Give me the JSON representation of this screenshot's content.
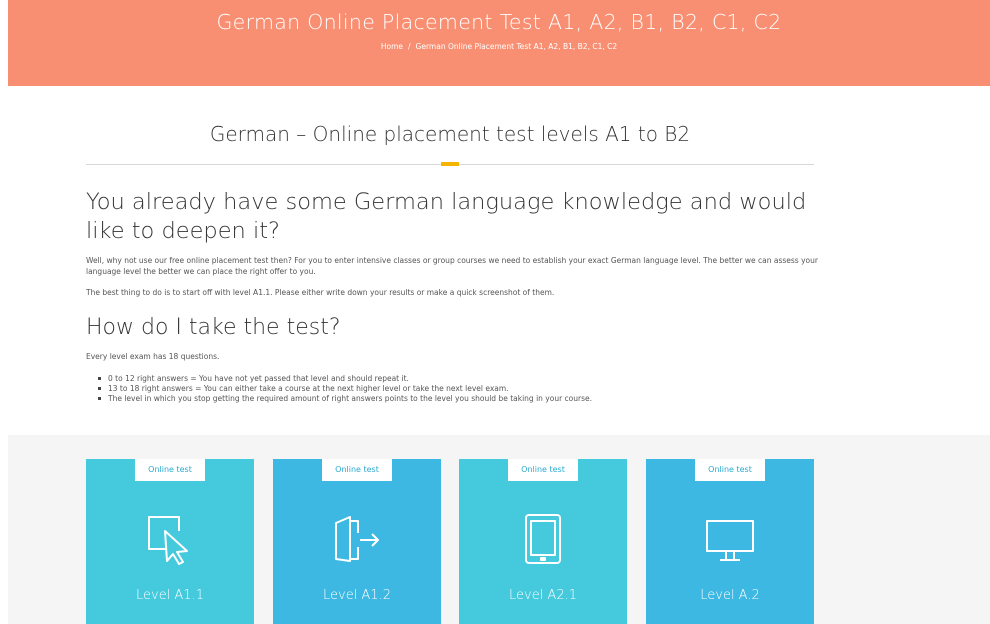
{
  "header": {
    "title": "German Online Placement Test A1, A2, B1, B2, C1, C2",
    "breadcrumb": {
      "home": "Home",
      "separator": "/",
      "current": "German Online Placement Test A1, A2, B1, B2, C1, C2"
    },
    "bg_color": "#f98f72"
  },
  "section": {
    "title": "German – Online placement test levels A1 to B2",
    "accent_color": "#f4b400"
  },
  "intro": {
    "heading": "You already have some German language knowledge and would like to deepen it?",
    "paragraph1": "Well, why not use our free online placement test then? For you to enter intensive classes or group courses we need to establish your exact German language level. The better we can assess your language level the better we can place the right offer to you.",
    "paragraph2": "The best thing to do is to start off with level A1.1. Please either write down your results or make a quick screenshot of them."
  },
  "howto": {
    "heading": "How do I take the test?",
    "paragraph": "Every level exam has 18 questions.",
    "bullets": [
      "0 to 12 right answers = You have not yet passed that level and should repeat it.",
      "13 to 18 right answers = You can either take a course at the next higher level or take the next level exam.",
      "The level in which you stop getting the required amount of right answers points to the level you should be taking in your course."
    ]
  },
  "cards": [
    {
      "badge": "Online test",
      "icon": "cursor-click-icon",
      "label": "Level A1.1",
      "color": "#44c9dd"
    },
    {
      "badge": "Online test",
      "icon": "door-exit-icon",
      "label": "Level A1.2",
      "color": "#3db8e2"
    },
    {
      "badge": "Online test",
      "icon": "tablet-icon",
      "label": "Level A2.1",
      "color": "#44c9dd"
    },
    {
      "badge": "Online test",
      "icon": "monitor-icon",
      "label": "Level A.2",
      "color": "#3db8e2"
    }
  ]
}
